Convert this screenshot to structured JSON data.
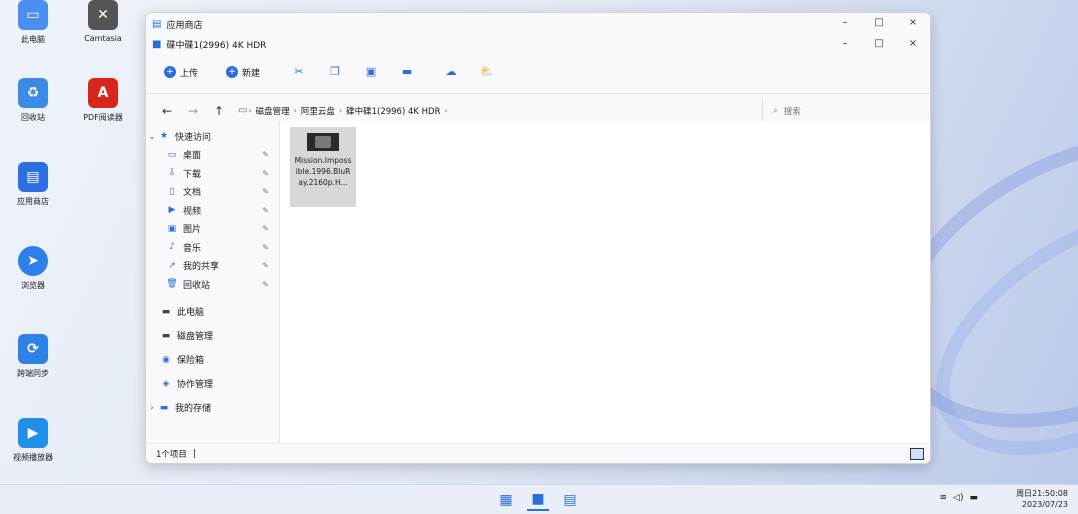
{
  "desktop": {
    "icons": [
      {
        "label": "此电脑",
        "icon": "computer-icon"
      },
      {
        "label": "Camtasia",
        "icon": "camtasia-icon"
      },
      {
        "label": "回收站",
        "icon": "recycle-bin-icon"
      },
      {
        "label": "PDF阅读器",
        "icon": "pdf-icon"
      },
      {
        "label": "应用商店",
        "icon": "store-icon"
      },
      {
        "label": "浏览器",
        "icon": "browser-icon"
      },
      {
        "label": "跨端同步",
        "icon": "sync-icon"
      },
      {
        "label": "视频播放器",
        "icon": "video-player-icon"
      }
    ]
  },
  "window": {
    "title1": "应用商店",
    "title2": "碟中碟1(2996) 4K HDR",
    "controls": {
      "minimize": "–",
      "maximize": "□",
      "close": "×"
    },
    "toolbar": {
      "upload_label": "上传",
      "new_label": "新建"
    },
    "address": {
      "crumbs": [
        "磁盘管理",
        "阿里云盘",
        "碟中碟1(2996) 4K HDR"
      ],
      "search_placeholder": "搜索"
    },
    "sidebar": {
      "quick_access": "快速访问",
      "pinned": [
        {
          "label": "桌面",
          "icon": "desktop-icon"
        },
        {
          "label": "下载",
          "icon": "download-icon"
        },
        {
          "label": "文档",
          "icon": "document-icon"
        },
        {
          "label": "视频",
          "icon": "video-icon"
        },
        {
          "label": "图片",
          "icon": "picture-icon"
        },
        {
          "label": "音乐",
          "icon": "music-icon"
        },
        {
          "label": "我的共享",
          "icon": "share-icon"
        },
        {
          "label": "回收站",
          "icon": "trash-icon"
        }
      ],
      "sections": [
        {
          "label": "此电脑",
          "icon": "pc-icon"
        },
        {
          "label": "磁盘管理",
          "icon": "disk-icon"
        },
        {
          "label": "保险箱",
          "icon": "safe-icon"
        },
        {
          "label": "协作管理",
          "icon": "collab-icon"
        },
        {
          "label": "我的存储",
          "icon": "storage-icon"
        }
      ]
    },
    "file": {
      "name": "Mission.Impossible.1996.BluRay.2160p.H..."
    },
    "status": "1个项目"
  },
  "taskbar": {
    "clock_time": "周日21:50:08",
    "clock_date": "2023/07/23"
  }
}
